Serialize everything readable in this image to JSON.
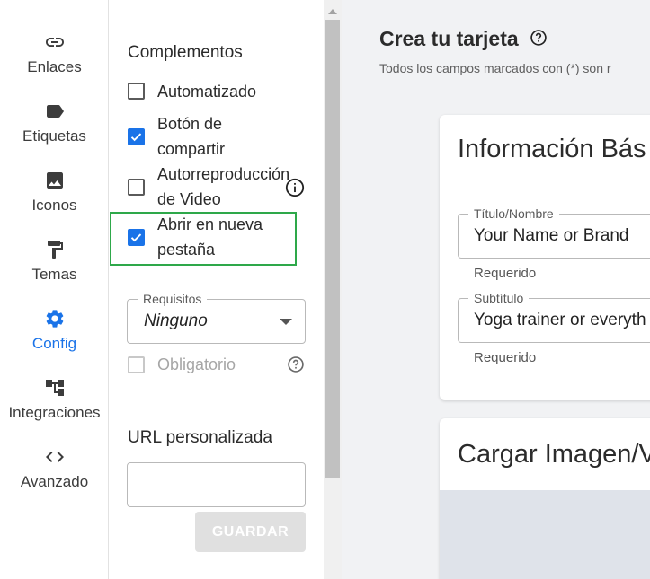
{
  "nav": {
    "items": [
      {
        "label": "Enlaces",
        "icon": "link-icon"
      },
      {
        "label": "Etiquetas",
        "icon": "label-icon"
      },
      {
        "label": "Iconos",
        "icon": "image-icon"
      },
      {
        "label": "Temas",
        "icon": "paint-roller-icon"
      },
      {
        "label": "Config",
        "icon": "gear-icon"
      },
      {
        "label": "Integraciones",
        "icon": "account-tree-icon"
      },
      {
        "label": "Avanzado",
        "icon": "code-icon"
      }
    ],
    "active_label": "Config",
    "active_color": "#1a73e8"
  },
  "settings": {
    "complements_title": "Complementos",
    "options": [
      {
        "label": "Automatizado",
        "checked": false
      },
      {
        "label_line1": "Botón de",
        "label_line2": "compartir",
        "checked": true
      },
      {
        "label_line1": "Autorreproducción",
        "label_line2": "de Video",
        "checked": false
      },
      {
        "label_line1": "Abrir en nueva",
        "label_line2": "pestaña",
        "checked": true
      }
    ],
    "requirements": {
      "legend": "Requisitos",
      "selected": "Ninguno"
    },
    "mandatory_label": "Obligatorio",
    "custom_url_title": "URL personalizada",
    "custom_url_value": "",
    "save_label": "GUARDAR",
    "highlight_color": "#2ea84a"
  },
  "main": {
    "title": "Crea tu tarjeta",
    "subtitle": "Todos los campos marcados con (*) son r",
    "basic_info_card": {
      "title": "Información Bás",
      "fields": [
        {
          "legend": "Título/Nombre",
          "value": "Your Name or Brand",
          "helper": "Requerido"
        },
        {
          "legend": "Subtítulo",
          "value": "Yoga trainer or everyth",
          "helper": "Requerido"
        }
      ]
    },
    "upload_card": {
      "title": "Cargar Imagen/V"
    }
  }
}
